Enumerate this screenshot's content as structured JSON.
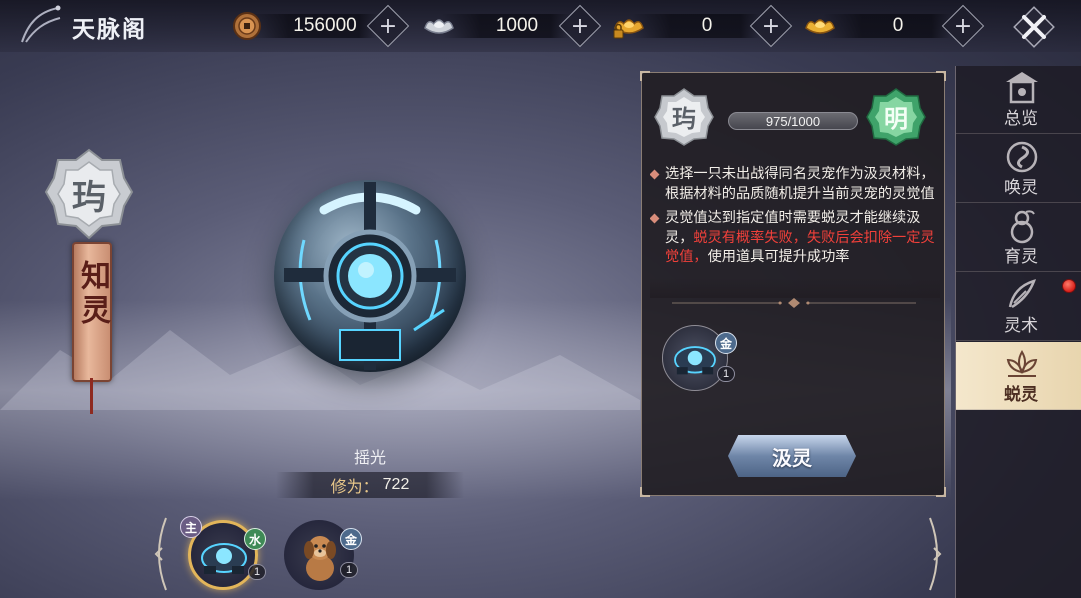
{
  "header": {
    "title": "天脉阁"
  },
  "currencies": [
    {
      "icon": "copper-coin-icon",
      "value": "156000"
    },
    {
      "icon": "silver-ingot-icon",
      "value": "1000"
    },
    {
      "icon": "locked-gold-ingot-icon",
      "value": "0"
    },
    {
      "icon": "gold-ingot-icon",
      "value": "0"
    }
  ],
  "emblem": {
    "seal_char": "玙",
    "banner_text": "知灵"
  },
  "pet": {
    "name": "摇光",
    "cultivation_label": "修为：",
    "cultivation_value": "722"
  },
  "slots": [
    {
      "role_tag": "主",
      "element": "水",
      "count": "1",
      "active": true
    },
    {
      "element": "金",
      "count": "1",
      "active": false
    }
  ],
  "panel": {
    "left_badge": "玙",
    "right_badge": "明",
    "progress_text": "975/1000",
    "progress": {
      "current": 975,
      "max": 1000
    },
    "desc1": "选择一只未出战得同名灵宠作为汲灵材料，根据材料的品质随机提升当前灵宠的灵觉值",
    "desc2_a": "灵觉值达到指定值时需要蜕灵才能继续汲灵，",
    "desc2_red": "蜕灵有概率失败，失败后会扣除一定灵觉值，",
    "desc2_b": "使用道具可提升成功率",
    "material": {
      "element": "金",
      "count": "1"
    },
    "absorb_button": "汲灵"
  },
  "tabs": [
    {
      "label": "总览",
      "icon": "pavilion-icon"
    },
    {
      "label": "唤灵",
      "icon": "swirl-icon"
    },
    {
      "label": "育灵",
      "icon": "gourd-icon"
    },
    {
      "label": "灵术",
      "icon": "feather-icon",
      "notify": true
    },
    {
      "label": "蜕灵",
      "icon": "lotus-icon",
      "active": true
    }
  ],
  "colors": {
    "accent_gold": "#e2b55a",
    "warning_red": "#f0403a",
    "active_tab": "#f4e7cc"
  }
}
